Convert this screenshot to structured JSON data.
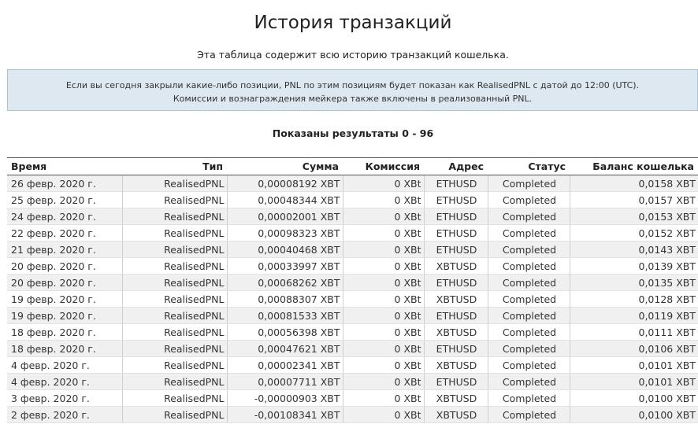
{
  "page": {
    "title": "История транзакций",
    "subtitle": "Эта таблица содержит всю историю транзакций кошелька."
  },
  "info": {
    "line1": "Если вы сегодня закрыли какие-либо позиции, PNL по этим позициям будет показан как RealisedPNL с датой до 12:00 (UTC).",
    "line2": "Комиссии и вознаграждения мейкера также включены в реализованный PNL."
  },
  "results_text": "Показаны результаты 0 - 96",
  "table": {
    "headers": {
      "time": "Время",
      "type": "Тип",
      "amount": "Сумма",
      "fee": "Комиссия",
      "address": "Адрес",
      "status": "Статус",
      "balance": "Баланс кошелька"
    },
    "rows": [
      {
        "time": "26 февр. 2020 г.",
        "type": "RealisedPNL",
        "amount": "0,00008192 XBT",
        "fee": "0 XBt",
        "address": "ETHUSD",
        "status": "Completed",
        "balance": "0,0158 XBT"
      },
      {
        "time": "25 февр. 2020 г.",
        "type": "RealisedPNL",
        "amount": "0,00048344 XBT",
        "fee": "0 XBt",
        "address": "ETHUSD",
        "status": "Completed",
        "balance": "0,0157 XBT"
      },
      {
        "time": "24 февр. 2020 г.",
        "type": "RealisedPNL",
        "amount": "0,00002001 XBT",
        "fee": "0 XBt",
        "address": "ETHUSD",
        "status": "Completed",
        "balance": "0,0153 XBT"
      },
      {
        "time": "22 февр. 2020 г.",
        "type": "RealisedPNL",
        "amount": "0,00098323 XBT",
        "fee": "0 XBt",
        "address": "ETHUSD",
        "status": "Completed",
        "balance": "0,0152 XBT"
      },
      {
        "time": "21 февр. 2020 г.",
        "type": "RealisedPNL",
        "amount": "0,00040468 XBT",
        "fee": "0 XBt",
        "address": "ETHUSD",
        "status": "Completed",
        "balance": "0,0143 XBT"
      },
      {
        "time": "20 февр. 2020 г.",
        "type": "RealisedPNL",
        "amount": "0,00033997 XBT",
        "fee": "0 XBt",
        "address": "XBTUSD",
        "status": "Completed",
        "balance": "0,0139 XBT"
      },
      {
        "time": "20 февр. 2020 г.",
        "type": "RealisedPNL",
        "amount": "0,00068262 XBT",
        "fee": "0 XBt",
        "address": "ETHUSD",
        "status": "Completed",
        "balance": "0,0135 XBT"
      },
      {
        "time": "19 февр. 2020 г.",
        "type": "RealisedPNL",
        "amount": "0,00088307 XBT",
        "fee": "0 XBt",
        "address": "XBTUSD",
        "status": "Completed",
        "balance": "0,0128 XBT"
      },
      {
        "time": "19 февр. 2020 г.",
        "type": "RealisedPNL",
        "amount": "0,00081533 XBT",
        "fee": "0 XBt",
        "address": "ETHUSD",
        "status": "Completed",
        "balance": "0,0119 XBT"
      },
      {
        "time": "18 февр. 2020 г.",
        "type": "RealisedPNL",
        "amount": "0,00056398 XBT",
        "fee": "0 XBt",
        "address": "XBTUSD",
        "status": "Completed",
        "balance": "0,0111 XBT"
      },
      {
        "time": "18 февр. 2020 г.",
        "type": "RealisedPNL",
        "amount": "0,00047621 XBT",
        "fee": "0 XBt",
        "address": "ETHUSD",
        "status": "Completed",
        "balance": "0,0106 XBT"
      },
      {
        "time": "4 февр. 2020 г.",
        "type": "RealisedPNL",
        "amount": "0,00002341 XBT",
        "fee": "0 XBt",
        "address": "XBTUSD",
        "status": "Completed",
        "balance": "0,0101 XBT"
      },
      {
        "time": "4 февр. 2020 г.",
        "type": "RealisedPNL",
        "amount": "0,00007711 XBT",
        "fee": "0 XBt",
        "address": "ETHUSD",
        "status": "Completed",
        "balance": "0,0101 XBT"
      },
      {
        "time": "3 февр. 2020 г.",
        "type": "RealisedPNL",
        "amount": "-0,00000903 XBT",
        "fee": "0 XBt",
        "address": "XBTUSD",
        "status": "Completed",
        "balance": "0,0100 XBT"
      },
      {
        "time": "2 февр. 2020 г.",
        "type": "RealisedPNL",
        "amount": "-0,00108341 XBT",
        "fee": "0 XBt",
        "address": "XBTUSD",
        "status": "Completed",
        "balance": "0,0100 XBT"
      }
    ]
  }
}
